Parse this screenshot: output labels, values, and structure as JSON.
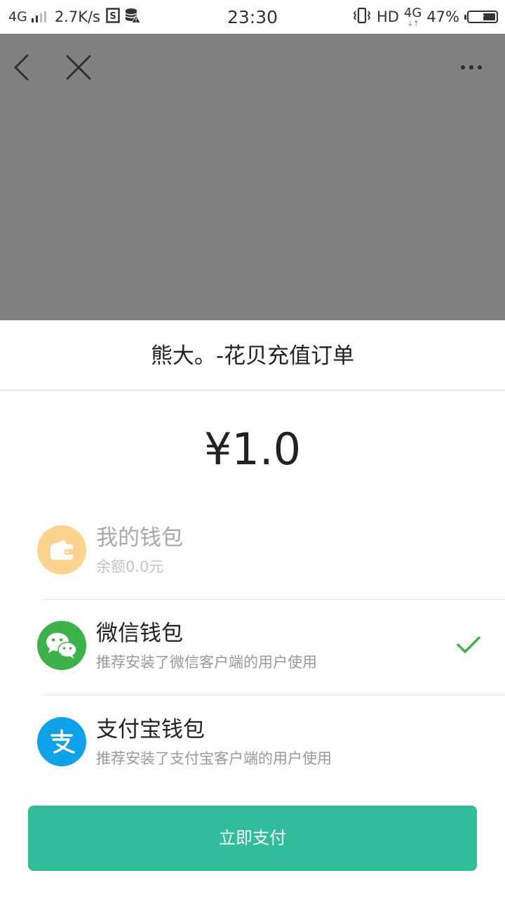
{
  "status_bar": {
    "network_type": "4G",
    "speed": "2.7K/s",
    "time": "23:30",
    "hd_label": "HD",
    "network_type_right": "4G",
    "battery_percent": "47%",
    "battery_level": 0.47
  },
  "webview": {
    "back_icon": "chevron-left-icon",
    "close_icon": "close-icon",
    "more_icon": "more-dots-icon"
  },
  "payment_sheet": {
    "title": "熊大。-花贝充值订单",
    "amount": "¥1.0",
    "methods": [
      {
        "name": "我的钱包",
        "description": "余额0.0元",
        "icon": "wallet-icon",
        "color": "#fbd590",
        "enabled": false,
        "selected": false
      },
      {
        "name": "微信钱包",
        "description": "推荐安装了微信客户端的用户使用",
        "icon": "wechat-icon",
        "color": "#3cb34a",
        "enabled": true,
        "selected": true
      },
      {
        "name": "支付宝钱包",
        "description": "推荐安装了支付宝客户端的用户使用",
        "icon": "alipay-icon",
        "color": "#0fa2e8",
        "enabled": true,
        "selected": false
      }
    ],
    "pay_button_label": "立即支付",
    "accent_color": "#31bd99",
    "check_color": "#3cb34a"
  }
}
